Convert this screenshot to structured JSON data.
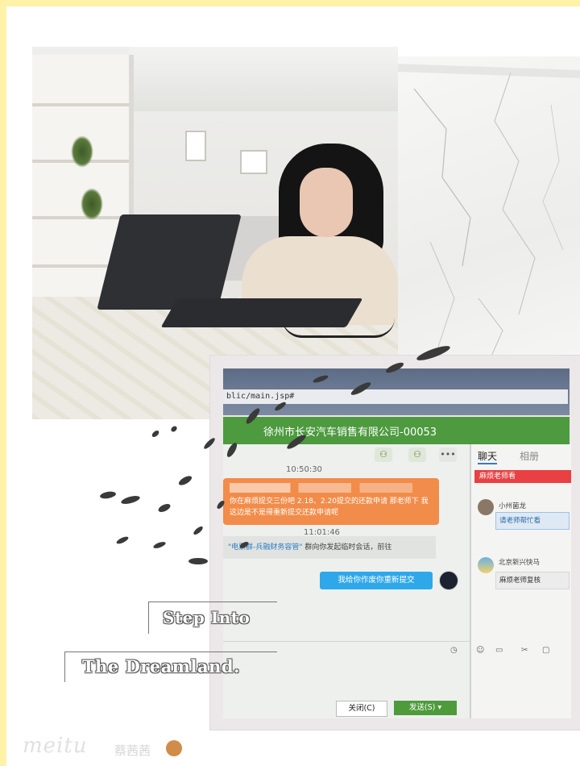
{
  "browser": {
    "url": "blic/main.jsp#"
  },
  "chat_window": {
    "title": "徐州市长安汽车销售有限公司-00053",
    "timestamp_1": "10:50:30",
    "message_orange": "你在麻烦提交三份吧 2.18、2.20提交的还款申请 那老师下 我这边是不是得重新提交还款申请呢",
    "timestamp_2": "11:01:46",
    "notice_prefix": "\"电票群-兵融财务容管\"",
    "notice_text": "群向你发起临时会话，前往",
    "notice_link": "前往",
    "message_blue": "我给你作废你重新提交",
    "button_close": "关闭(C)",
    "button_send": "发送(S)",
    "send_dropdown": "⌄"
  },
  "side_panel": {
    "tab_chat": "聊天",
    "tab_album": "相册",
    "red_tag": "麻烦老师看",
    "contact_1_name": "小州菌龙",
    "contact_1_msg": "请老师帮忙看",
    "contact_2_name": "北京新兴快马",
    "contact_2_msg": "麻烦老师复核"
  },
  "overlay": {
    "line1": "Step Into",
    "line2": "The Dreamland."
  },
  "footer": {
    "signature": "meitu",
    "name": "蔡茜茜"
  },
  "colors": {
    "page_border": "#fdf2a8",
    "title_green": "#4d9a3f",
    "orange_bubble": "#f28c4a",
    "blue_bubble": "#2fa8ea",
    "red_tag": "#e84043"
  }
}
